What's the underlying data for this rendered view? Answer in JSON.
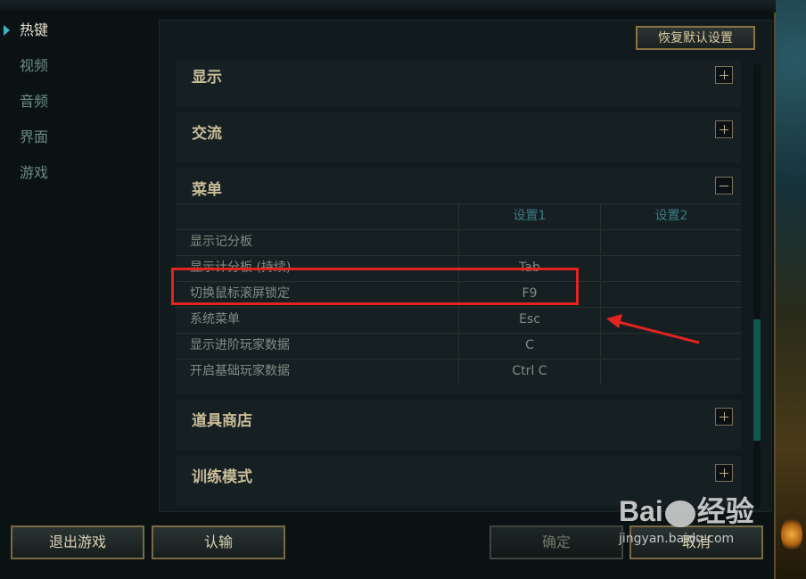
{
  "sidebar": {
    "items": [
      {
        "label": "热键",
        "active": true
      },
      {
        "label": "视频",
        "active": false
      },
      {
        "label": "音频",
        "active": false
      },
      {
        "label": "界面",
        "active": false
      },
      {
        "label": "游戏",
        "active": false
      }
    ]
  },
  "header": {
    "reset_label": "恢复默认设置"
  },
  "sections": {
    "display": {
      "title": "显示",
      "icon": "plus-icon"
    },
    "chat": {
      "title": "交流",
      "icon": "plus-icon"
    },
    "menu": {
      "title": "菜单",
      "icon": "minus-icon"
    },
    "shop": {
      "title": "道具商店",
      "icon": "plus-icon"
    },
    "training": {
      "title": "训练模式",
      "icon": "plus-icon"
    }
  },
  "menu_table": {
    "headers": [
      "",
      "设置1",
      "设置2"
    ],
    "rows": [
      {
        "action": "显示记分板",
        "key1": "",
        "key2": ""
      },
      {
        "action": "显示计分板 (持续)",
        "key1": "Tab",
        "key2": ""
      },
      {
        "action": "切换鼠标滚屏锁定",
        "key1": "F9",
        "key2": ""
      },
      {
        "action": "系统菜单",
        "key1": "Esc",
        "key2": ""
      },
      {
        "action": "显示进阶玩家数据",
        "key1": "C",
        "key2": ""
      },
      {
        "action": "开启基础玩家数据",
        "key1": "Ctrl  C",
        "key2": ""
      }
    ]
  },
  "footer": {
    "quit_label": "退出游戏",
    "surrender_label": "认输",
    "confirm_label": "确定",
    "cancel_label": "取消"
  },
  "watermark": {
    "logo": "Bai",
    "logo_suffix": "经验",
    "url": "jingyan.baidu.com"
  },
  "colors": {
    "annotation": "#e3231f",
    "accent": "#3fb6c3",
    "gold_border": "#8a7444"
  }
}
